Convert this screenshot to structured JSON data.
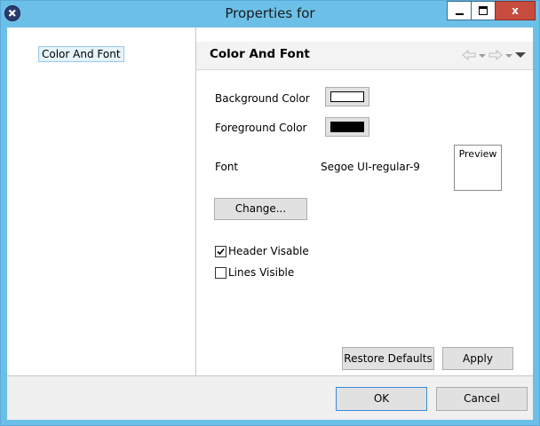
{
  "window": {
    "title": "Properties for",
    "minimize_icon": "minimize-icon",
    "maximize_icon": "maximize-icon",
    "close_label": "x"
  },
  "tree": {
    "items": [
      {
        "label": "Color And Font",
        "selected": true
      }
    ]
  },
  "page": {
    "title": "Color And Font",
    "nav_icons": [
      "back-arrow-icon",
      "dropdown-icon",
      "forward-arrow-icon",
      "dropdown-icon",
      "menu-icon"
    ],
    "background_color": {
      "label": "Background Color",
      "value": "#ffffff"
    },
    "foreground_color": {
      "label": "Foreground Color",
      "value": "#000000"
    },
    "font": {
      "label": "Font",
      "value": "Segoe UI-regular-9",
      "preview_label": "Preview"
    },
    "change_button": "Change...",
    "header_visible": {
      "label": "Header Visable",
      "checked": true
    },
    "lines_visible": {
      "label": "Lines Visible",
      "checked": false
    },
    "restore_defaults_button": "Restore Defaults",
    "apply_button": "Apply"
  },
  "footer": {
    "ok_button": "OK",
    "cancel_button": "Cancel"
  },
  "colors": {
    "titlebar": "#6cc0e8",
    "close_button": "#c84c3e",
    "selection": "#e5f3fb"
  }
}
